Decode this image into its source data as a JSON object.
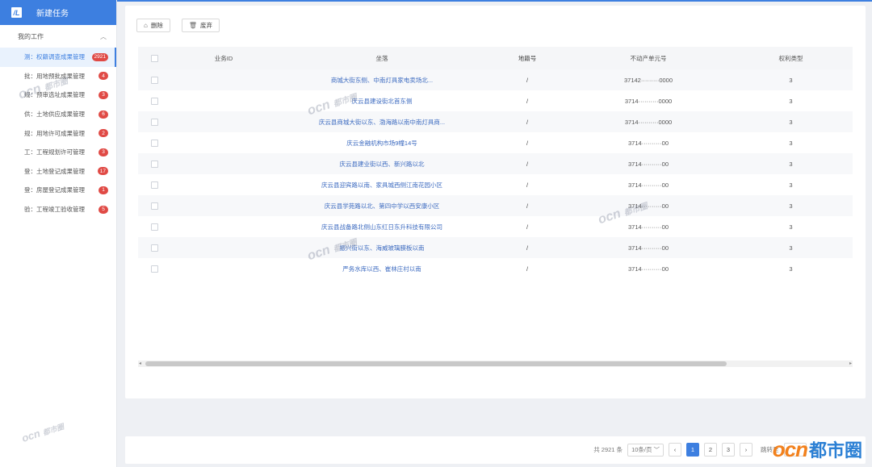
{
  "sidebar": {
    "new_task": "新建任务",
    "group_label": "我的工作",
    "items": [
      {
        "label": "测：权籍调查成果管理",
        "count": "2921",
        "active": true
      },
      {
        "label": "批：用地预批成果管理",
        "count": "4"
      },
      {
        "label": "规：预审选址成果管理",
        "count": "3"
      },
      {
        "label": "供：土地供应成果管理",
        "count": "6"
      },
      {
        "label": "规：用地许可成果管理",
        "count": "2"
      },
      {
        "label": "工：工程规划许可管理",
        "count": "3"
      },
      {
        "label": "登：土地登记成果管理",
        "count": "17"
      },
      {
        "label": "登：房屋登记成果管理",
        "count": "1"
      },
      {
        "label": "验：工程竣工验收管理",
        "count": "5"
      }
    ]
  },
  "toolbar": {
    "delete_label": "删除",
    "discard_label": "废弃"
  },
  "table": {
    "headers": [
      "业务ID",
      "坐落",
      "地籍号",
      "不动产单元号",
      "权利类型"
    ],
    "rows": [
      {
        "addr": "商城大街东侧、中南灯具家电卖场北...",
        "land": "/",
        "unit": "37142·········0000",
        "type": "3"
      },
      {
        "addr": "庆云县建设街北首东侧",
        "land": "/",
        "unit": "3714··········0000",
        "type": "3"
      },
      {
        "addr": "庆云县商城大街以东、渤海路以南中南灯具商...",
        "land": "/",
        "unit": "3714··········0000",
        "type": "3"
      },
      {
        "addr": "庆云金融机构市场9幢14号",
        "land": "/",
        "unit": "3714··········00",
        "type": "3"
      },
      {
        "addr": "庆云县建业街以西、新兴路以北",
        "land": "/",
        "unit": "3714··········00",
        "type": "3"
      },
      {
        "addr": "庆云县迎宾路以南、家具城西侧江南花园小区",
        "land": "/",
        "unit": "3714··········00",
        "type": "3"
      },
      {
        "addr": "庆云县学苑路以北、第四中学以西安康小区",
        "land": "/",
        "unit": "3714··········00",
        "type": "3"
      },
      {
        "addr": "庆云县战备路北侧山东红日东升科技有限公司",
        "land": "/",
        "unit": "3714··········00",
        "type": "3"
      },
      {
        "addr": "振兴街以东、海威玻璃膜板以南",
        "land": "/",
        "unit": "3714··········00",
        "type": "3"
      },
      {
        "addr": "严务水库以西、崔林庄村以南",
        "land": "/",
        "unit": "3714··········00",
        "type": "3"
      }
    ]
  },
  "pager": {
    "total": "共 2921 条",
    "page_size": "10条/页",
    "pages": [
      "1",
      "2",
      "3"
    ],
    "current": "1",
    "prev": "‹",
    "next": "›",
    "jump_label": "跳转至",
    "page_unit": "页"
  },
  "watermark": {
    "en": "ocn",
    "cn": "都市圈"
  },
  "colors": {
    "accent": "#3d7fe0",
    "badge": "#e04a45",
    "brand_orange": "#f2811d",
    "brand_blue": "#2a7fd4"
  }
}
